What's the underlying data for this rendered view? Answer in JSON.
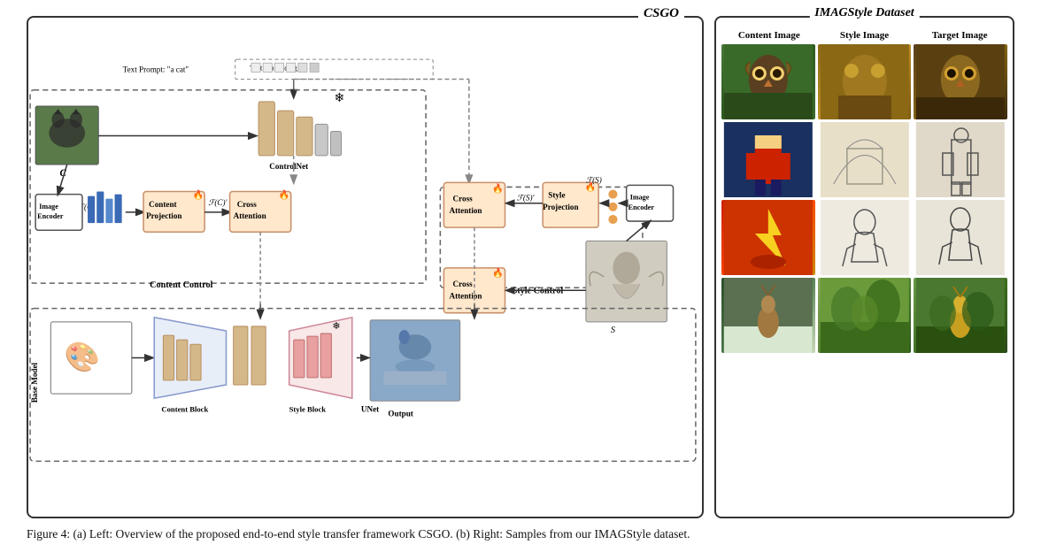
{
  "csgo": {
    "title": "CSGO",
    "text_prompt_label": "Text Prompt: \"a cat\"",
    "text_embedding_label": "Text Embedding",
    "controlnet_label": "ControlNet",
    "content_label": "C",
    "fc_label": "ℱ(C)",
    "fc_prime_label": "ℱ(C)′",
    "fs_label": "ℱ(S)",
    "fs_prime_label": "ℱ(S)′",
    "s_label": "S",
    "content_projection_label": "Content\nProjection",
    "cross_attention_1_label": "Cross\nAttention",
    "cross_attention_2_label": "Cross\nAttention",
    "cross_attention_3_label": "Cross\nAttention",
    "style_projection_label": "Style\nProjection",
    "image_encoder_label": "Image\nEncoder",
    "image_encoder2_label": "Image\nEncoder",
    "content_control_label": "Content  Control",
    "style_control_label": "Style Control",
    "base_model_label": "Base\nModel",
    "unet_label": "UNet",
    "content_block_label": "Content Block",
    "style_block_label": "Style Block",
    "output_label": "Output",
    "snowflake": "❄",
    "fire": "🔥"
  },
  "dataset": {
    "title": "IMAGStyle Dataset",
    "col1": "Content Image",
    "col2": "Style Image",
    "col3": "Target Image",
    "rows": [
      {
        "c1": "owl-forest",
        "c2": "golden-artwork",
        "c3": "owl-golden"
      },
      {
        "c1": "soldier-toy",
        "c2": "house-sketch",
        "c3": "soldier-sketch"
      },
      {
        "c1": "flash-hero",
        "c2": "figure-sketch",
        "c3": "figure-sketch2"
      },
      {
        "c1": "deer-winter",
        "c2": "green-painting",
        "c3": "deer-painting"
      }
    ]
  },
  "caption": {
    "text": "Figure 4: (a) Left: Overview of the proposed end-to-end style transfer framework CSGO. (b) Right: Samples from our IMAGStyle dataset."
  }
}
